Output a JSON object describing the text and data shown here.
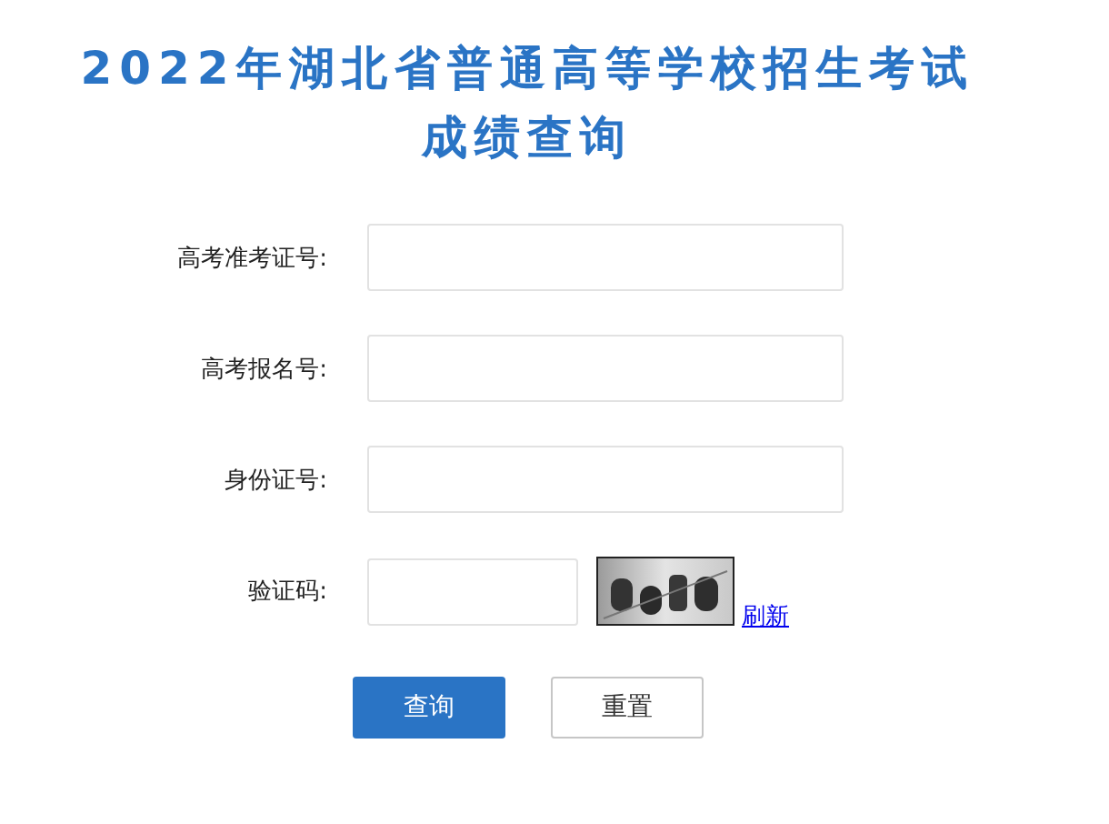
{
  "title_lines": [
    "2022年湖北省普通高等学校招生考试",
    "成绩查询"
  ],
  "fields": [
    {
      "kind": "text",
      "label": "高考准考证号:"
    },
    {
      "kind": "text",
      "label": "高考报名号:"
    },
    {
      "kind": "text",
      "label": "身份证号:"
    },
    {
      "kind": "captcha",
      "label": "验证码:",
      "link": "刷新"
    }
  ],
  "buttons": [
    {
      "label": "查询",
      "kind": "primary"
    },
    {
      "label": "重置",
      "kind": "secondary"
    }
  ]
}
